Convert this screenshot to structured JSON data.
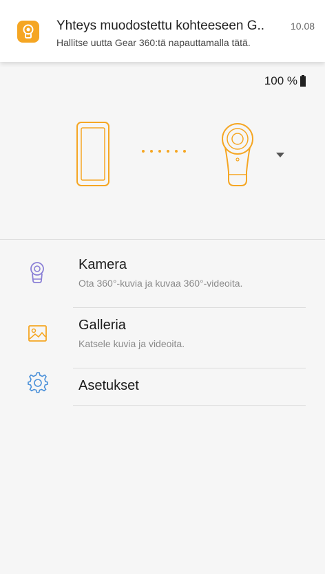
{
  "notification": {
    "title": "Yhteys muodostettu kohteeseen G..",
    "time": "10.08",
    "subtitle": "Hallitse uutta Gear 360:tä napauttamalla tätä."
  },
  "status": {
    "battery": "100 %"
  },
  "menu": [
    {
      "title": "Kamera",
      "desc": "Ota 360°-kuvia ja kuvaa 360°-videoita.",
      "icon": "camera-icon"
    },
    {
      "title": "Galleria",
      "desc": "Katsele kuvia ja videoita.",
      "icon": "gallery-icon"
    },
    {
      "title": "Asetukset",
      "desc": "",
      "icon": "settings-icon"
    }
  ],
  "colors": {
    "accent": "#f5a623",
    "camera_icon": "#8a7fd6",
    "settings_icon": "#4a90d9"
  }
}
